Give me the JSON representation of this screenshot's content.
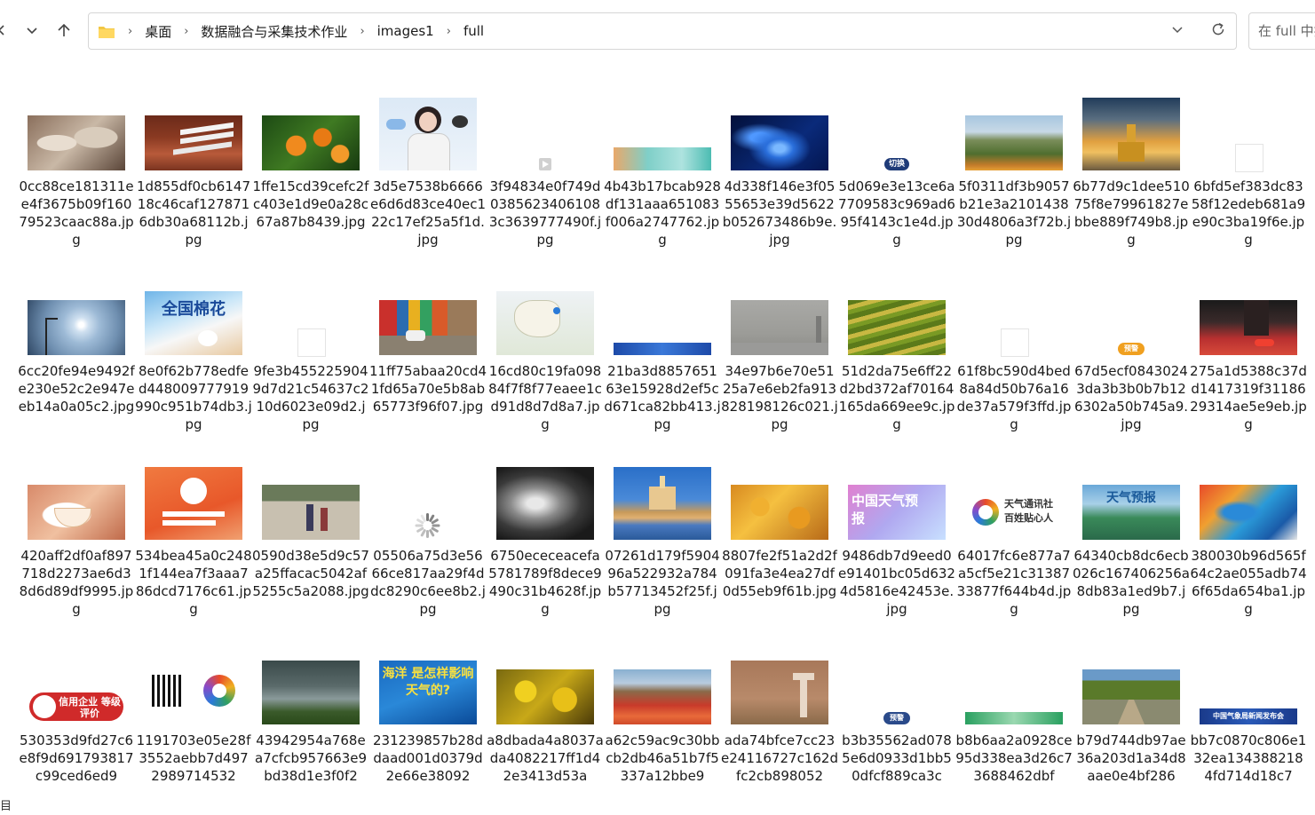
{
  "address": {
    "crumbs": [
      "桌面",
      "数据融合与采集技术作业",
      "images1",
      "full"
    ],
    "search_placeholder": "在 full 中搜"
  },
  "icons": {
    "back": "chevron-left-icon",
    "recent": "chevron-down-icon",
    "up": "arrow-up-icon",
    "folder": "folder-icon",
    "refresh": "refresh-icon"
  },
  "status": {
    "text": "目"
  },
  "files": [
    {
      "name": "0cc88ce181311ee4f3675b09f16079523caac88a.jpg",
      "thumb": "cloves"
    },
    {
      "name": "1d855df0cb614718c46caf1278716db30a68112b.jpg",
      "thumb": "bench"
    },
    {
      "name": "1ffe15cd39cefc2fc403e1d9e0a28c67a87b8439.jpg",
      "thumb": "persimmon"
    },
    {
      "name": "3d5e7538b6666e6d6d83ce40ec122c17ef25a5f1d.jpg",
      "thumb": "presenter"
    },
    {
      "name": "3f94834e0f749d03856234061083c3639777490f.jpg",
      "thumb": "video"
    },
    {
      "name": "4b43b17bcab928df131aaa651083f006a2747762.jpg",
      "thumb": "banner-teal"
    },
    {
      "name": "4d338f146e3f0555653e39d5622b052673486b9e.jpg",
      "thumb": "blue-flower"
    },
    {
      "name": "5d069e3e13ce6a7709583c969ad695f4143c1e4d.jpg",
      "thumb": "tag-switch",
      "label": "切换"
    },
    {
      "name": "5f0311df3b9057b21e3a210143830d4806a3f72b.jpg",
      "thumb": "mountain"
    },
    {
      "name": "6b77d9c1dee51075f8e79961827ebbe889f749b8.jpg",
      "thumb": "temple"
    },
    {
      "name": "6bfd5ef383dc8358f12edeb681a9e90c3ba19f6e.jpg",
      "thumb": "blank"
    },
    {
      "name": "6cc20fe94e9492fe230e52c2e947eeb14a0a05c2.jpg",
      "thumb": "halo"
    },
    {
      "name": "8e0f62b778edfed448009777919990c951b74db3.jpg",
      "thumb": "cotton",
      "label": "全国棉花"
    },
    {
      "name": "9fe3b4552259049d7d21c54637c210d6023e09d2.jpg",
      "thumb": "blank"
    },
    {
      "name": "11ff75abaa20cd41fd65a70e5b8ab65773f96f07.jpg",
      "thumb": "street"
    },
    {
      "name": "16cd80c19fa09884f7f8f77eaee1cd91d8d7d8a7.jpg",
      "thumb": "map"
    },
    {
      "name": "21ba3d885765163e15928d2ef5cd671ca82bb413.jpg",
      "thumb": "banner-blue"
    },
    {
      "name": "34e97b6e70e5125a7e6eb2fa913828198126c021.jpg",
      "thumb": "haze"
    },
    {
      "name": "51d2da75e6ff22d2bd372af70164165da669ee9c.jpg",
      "thumb": "terraces"
    },
    {
      "name": "61f8bc590d4bed8a84d50b76a16de37a579f3ffd.jpg",
      "thumb": "blank"
    },
    {
      "name": "67d5ecf08430243da3b3b0b7b126302a50b745a9.jpg",
      "thumb": "tag-warn",
      "label": "预警"
    },
    {
      "name": "275a1d5388c37dd1417319f3118629314ae5e9eb.jpg",
      "thumb": "runner"
    },
    {
      "name": "420aff2df0af897718d2273ae6d38d6d89df9995.jpg",
      "thumb": "teacup"
    },
    {
      "name": "534bea45a0c2481f144ea7f3aaa786dcd7176c61.jpg",
      "thumb": "orange-poster"
    },
    {
      "name": "0590d38e5d9c57a25ffacac5042af5255c5a2088.jpg",
      "thumb": "family"
    },
    {
      "name": "05506a75d3e5666ce817aa29f4ddc8290c6ee8b2.jpg",
      "thumb": "loading"
    },
    {
      "name": "6750ececeacefa5781789f8dece9490c31b4628f.jpg",
      "thumb": "satellite"
    },
    {
      "name": "07261d179f590496a522932a784b57713452f25f.jpg",
      "thumb": "castle"
    },
    {
      "name": "8807fe2f51a2d2f091fa3e4ea27df0d55eb9f61b.jpg",
      "thumb": "ginkgo"
    },
    {
      "name": "9486db7d9eed0e91401bc05d6324d5816e42453e.jpg",
      "thumb": "weather-logo",
      "label": "中国天气预报"
    },
    {
      "name": "64017fc6e877a7a5cf5e21c3138733877f644b4d.jpg",
      "thumb": "news-logo",
      "label": "天气通讯社 百姓贴心人"
    },
    {
      "name": "64340cb8dc6ecb026c167406256a8db83a1ed9b7.jpg",
      "thumb": "forecast",
      "label": "天气预报"
    },
    {
      "name": "380030b96d565f64c2ae055adb746f65da654ba1.jpg",
      "thumb": "swirl"
    },
    {
      "name": "530353d9fd27c6e8f9d691793817c99ced6ed9",
      "thumb": "credit",
      "label": "信用企业 等级评价"
    },
    {
      "name": "1191703e05e28f3552aebb7d4972989714532",
      "thumb": "qrcode"
    },
    {
      "name": "43942954a768ea7cfcb957663e9bd38d1e3f0f2",
      "thumb": "storm"
    },
    {
      "name": "231239857b28ddaad001d0379d2e66e38092",
      "thumb": "ocean",
      "label": "海洋 是怎样影响 天气的?"
    },
    {
      "name": "a8dbada4a8037ada4082217ff1d42e3413d53a",
      "thumb": "yellow-leaves"
    },
    {
      "name": "a62c59ac9c30bbcb2db46a51b7f5337a12bbe9",
      "thumb": "red-hills"
    },
    {
      "name": "ada74bfce7cc23e24116727c162dfc2cb898052",
      "thumb": "sand-tower"
    },
    {
      "name": "b3b35562ad0785e6d0933d1bb50dfcf889ca3c",
      "thumb": "tag-warn2",
      "label": "预警"
    },
    {
      "name": "b8b6aa2a0928ce95d338ea3d26c73688462dbf",
      "thumb": "banner-green"
    },
    {
      "name": "b79d744db97ae36a203d1a34d8aae0e4bf286",
      "thumb": "path"
    },
    {
      "name": "bb7c0870c806e132ea1343882184fd714d18c7",
      "thumb": "banner-navy",
      "label": "中国气象局新闻发布会"
    }
  ]
}
